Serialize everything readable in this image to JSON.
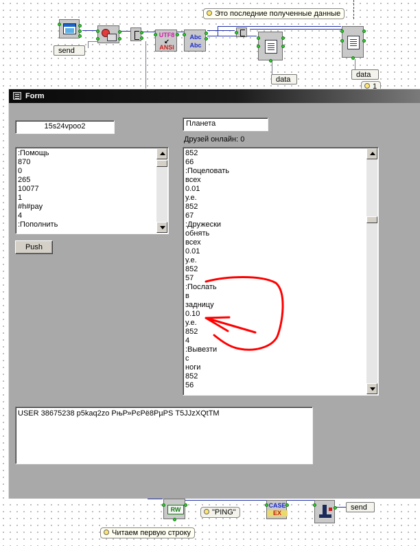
{
  "schema": {
    "comment_top": "Это последние полученные данные",
    "comment_bottom": "Читаем первую строку",
    "send_top": "send",
    "send_bottom": "send",
    "data_mid": "data",
    "data_right": "data",
    "ping_value": "\"PING\"",
    "const_right": "1",
    "utf8_label": "UTF8",
    "ansi_label": "ANSI",
    "abc_label": "Abc",
    "rw_label": "RW",
    "case_label": "CASE",
    "ex_label": "EX"
  },
  "form": {
    "title": "Form",
    "login_value": "15s24vpoo2",
    "planet_value": "Планета",
    "friends_label": "Друзей онлайн: 0",
    "push_label": "Push",
    "left_list": [
      ":Помощь",
      "870",
      "0",
      "265",
      "10077",
      "1",
      "#h#pay",
      "4",
      ":Пополнить"
    ],
    "right_list": [
      "852",
      "66",
      ":Поцеловать",
      "всех",
      "0.01",
      "у.е.",
      "852",
      "67",
      ":Дружески",
      "обнять",
      "всех",
      "0.01",
      "у.е.",
      "852",
      "57",
      ":Послать",
      "в",
      "задницу",
      "0.10",
      "у.е.",
      "852",
      "4",
      ":Вывезти",
      "с",
      "ноги",
      "852",
      "56"
    ],
    "output_text": "USER 38675238 p5kaq2zo РњР»РєРё8РµРЅ T5JJzXQtTM"
  },
  "colors": {
    "wire": "#1f2fa8",
    "pin": "#2fd12f",
    "title_bar": "#0a0a0a",
    "window_bg": "#a9a9a9",
    "annotation": "#ff0000"
  }
}
